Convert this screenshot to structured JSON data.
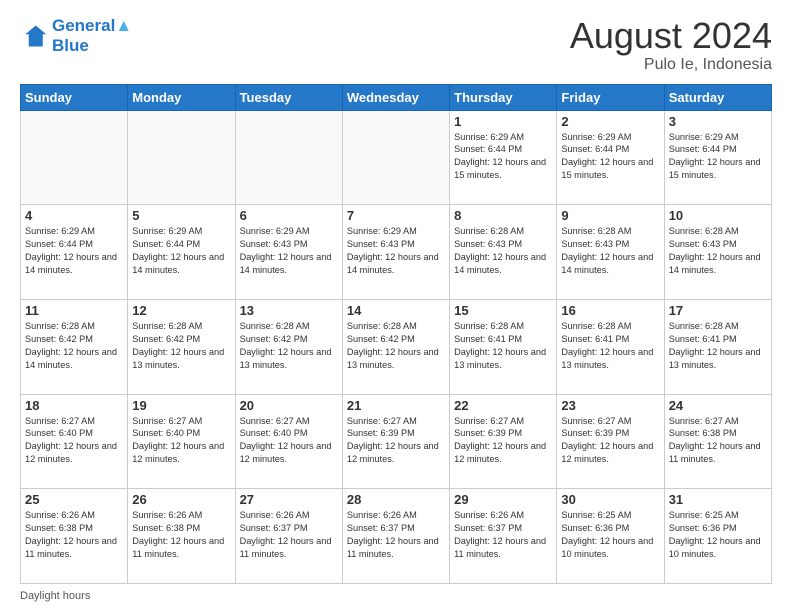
{
  "header": {
    "logo_line1": "General",
    "logo_line2": "Blue",
    "title": "August 2024",
    "subtitle": "Pulo Ie, Indonesia"
  },
  "days_of_week": [
    "Sunday",
    "Monday",
    "Tuesday",
    "Wednesday",
    "Thursday",
    "Friday",
    "Saturday"
  ],
  "weeks": [
    [
      {
        "day": "",
        "info": ""
      },
      {
        "day": "",
        "info": ""
      },
      {
        "day": "",
        "info": ""
      },
      {
        "day": "",
        "info": ""
      },
      {
        "day": "1",
        "info": "Sunrise: 6:29 AM\nSunset: 6:44 PM\nDaylight: 12 hours and 15 minutes."
      },
      {
        "day": "2",
        "info": "Sunrise: 6:29 AM\nSunset: 6:44 PM\nDaylight: 12 hours and 15 minutes."
      },
      {
        "day": "3",
        "info": "Sunrise: 6:29 AM\nSunset: 6:44 PM\nDaylight: 12 hours and 15 minutes."
      }
    ],
    [
      {
        "day": "4",
        "info": "Sunrise: 6:29 AM\nSunset: 6:44 PM\nDaylight: 12 hours and 14 minutes."
      },
      {
        "day": "5",
        "info": "Sunrise: 6:29 AM\nSunset: 6:44 PM\nDaylight: 12 hours and 14 minutes."
      },
      {
        "day": "6",
        "info": "Sunrise: 6:29 AM\nSunset: 6:43 PM\nDaylight: 12 hours and 14 minutes."
      },
      {
        "day": "7",
        "info": "Sunrise: 6:29 AM\nSunset: 6:43 PM\nDaylight: 12 hours and 14 minutes."
      },
      {
        "day": "8",
        "info": "Sunrise: 6:28 AM\nSunset: 6:43 PM\nDaylight: 12 hours and 14 minutes."
      },
      {
        "day": "9",
        "info": "Sunrise: 6:28 AM\nSunset: 6:43 PM\nDaylight: 12 hours and 14 minutes."
      },
      {
        "day": "10",
        "info": "Sunrise: 6:28 AM\nSunset: 6:43 PM\nDaylight: 12 hours and 14 minutes."
      }
    ],
    [
      {
        "day": "11",
        "info": "Sunrise: 6:28 AM\nSunset: 6:42 PM\nDaylight: 12 hours and 14 minutes."
      },
      {
        "day": "12",
        "info": "Sunrise: 6:28 AM\nSunset: 6:42 PM\nDaylight: 12 hours and 13 minutes."
      },
      {
        "day": "13",
        "info": "Sunrise: 6:28 AM\nSunset: 6:42 PM\nDaylight: 12 hours and 13 minutes."
      },
      {
        "day": "14",
        "info": "Sunrise: 6:28 AM\nSunset: 6:42 PM\nDaylight: 12 hours and 13 minutes."
      },
      {
        "day": "15",
        "info": "Sunrise: 6:28 AM\nSunset: 6:41 PM\nDaylight: 12 hours and 13 minutes."
      },
      {
        "day": "16",
        "info": "Sunrise: 6:28 AM\nSunset: 6:41 PM\nDaylight: 12 hours and 13 minutes."
      },
      {
        "day": "17",
        "info": "Sunrise: 6:28 AM\nSunset: 6:41 PM\nDaylight: 12 hours and 13 minutes."
      }
    ],
    [
      {
        "day": "18",
        "info": "Sunrise: 6:27 AM\nSunset: 6:40 PM\nDaylight: 12 hours and 12 minutes."
      },
      {
        "day": "19",
        "info": "Sunrise: 6:27 AM\nSunset: 6:40 PM\nDaylight: 12 hours and 12 minutes."
      },
      {
        "day": "20",
        "info": "Sunrise: 6:27 AM\nSunset: 6:40 PM\nDaylight: 12 hours and 12 minutes."
      },
      {
        "day": "21",
        "info": "Sunrise: 6:27 AM\nSunset: 6:39 PM\nDaylight: 12 hours and 12 minutes."
      },
      {
        "day": "22",
        "info": "Sunrise: 6:27 AM\nSunset: 6:39 PM\nDaylight: 12 hours and 12 minutes."
      },
      {
        "day": "23",
        "info": "Sunrise: 6:27 AM\nSunset: 6:39 PM\nDaylight: 12 hours and 12 minutes."
      },
      {
        "day": "24",
        "info": "Sunrise: 6:27 AM\nSunset: 6:38 PM\nDaylight: 12 hours and 11 minutes."
      }
    ],
    [
      {
        "day": "25",
        "info": "Sunrise: 6:26 AM\nSunset: 6:38 PM\nDaylight: 12 hours and 11 minutes."
      },
      {
        "day": "26",
        "info": "Sunrise: 6:26 AM\nSunset: 6:38 PM\nDaylight: 12 hours and 11 minutes."
      },
      {
        "day": "27",
        "info": "Sunrise: 6:26 AM\nSunset: 6:37 PM\nDaylight: 12 hours and 11 minutes."
      },
      {
        "day": "28",
        "info": "Sunrise: 6:26 AM\nSunset: 6:37 PM\nDaylight: 12 hours and 11 minutes."
      },
      {
        "day": "29",
        "info": "Sunrise: 6:26 AM\nSunset: 6:37 PM\nDaylight: 12 hours and 11 minutes."
      },
      {
        "day": "30",
        "info": "Sunrise: 6:25 AM\nSunset: 6:36 PM\nDaylight: 12 hours and 10 minutes."
      },
      {
        "day": "31",
        "info": "Sunrise: 6:25 AM\nSunset: 6:36 PM\nDaylight: 12 hours and 10 minutes."
      }
    ]
  ],
  "footer": {
    "text": "Daylight hours"
  }
}
